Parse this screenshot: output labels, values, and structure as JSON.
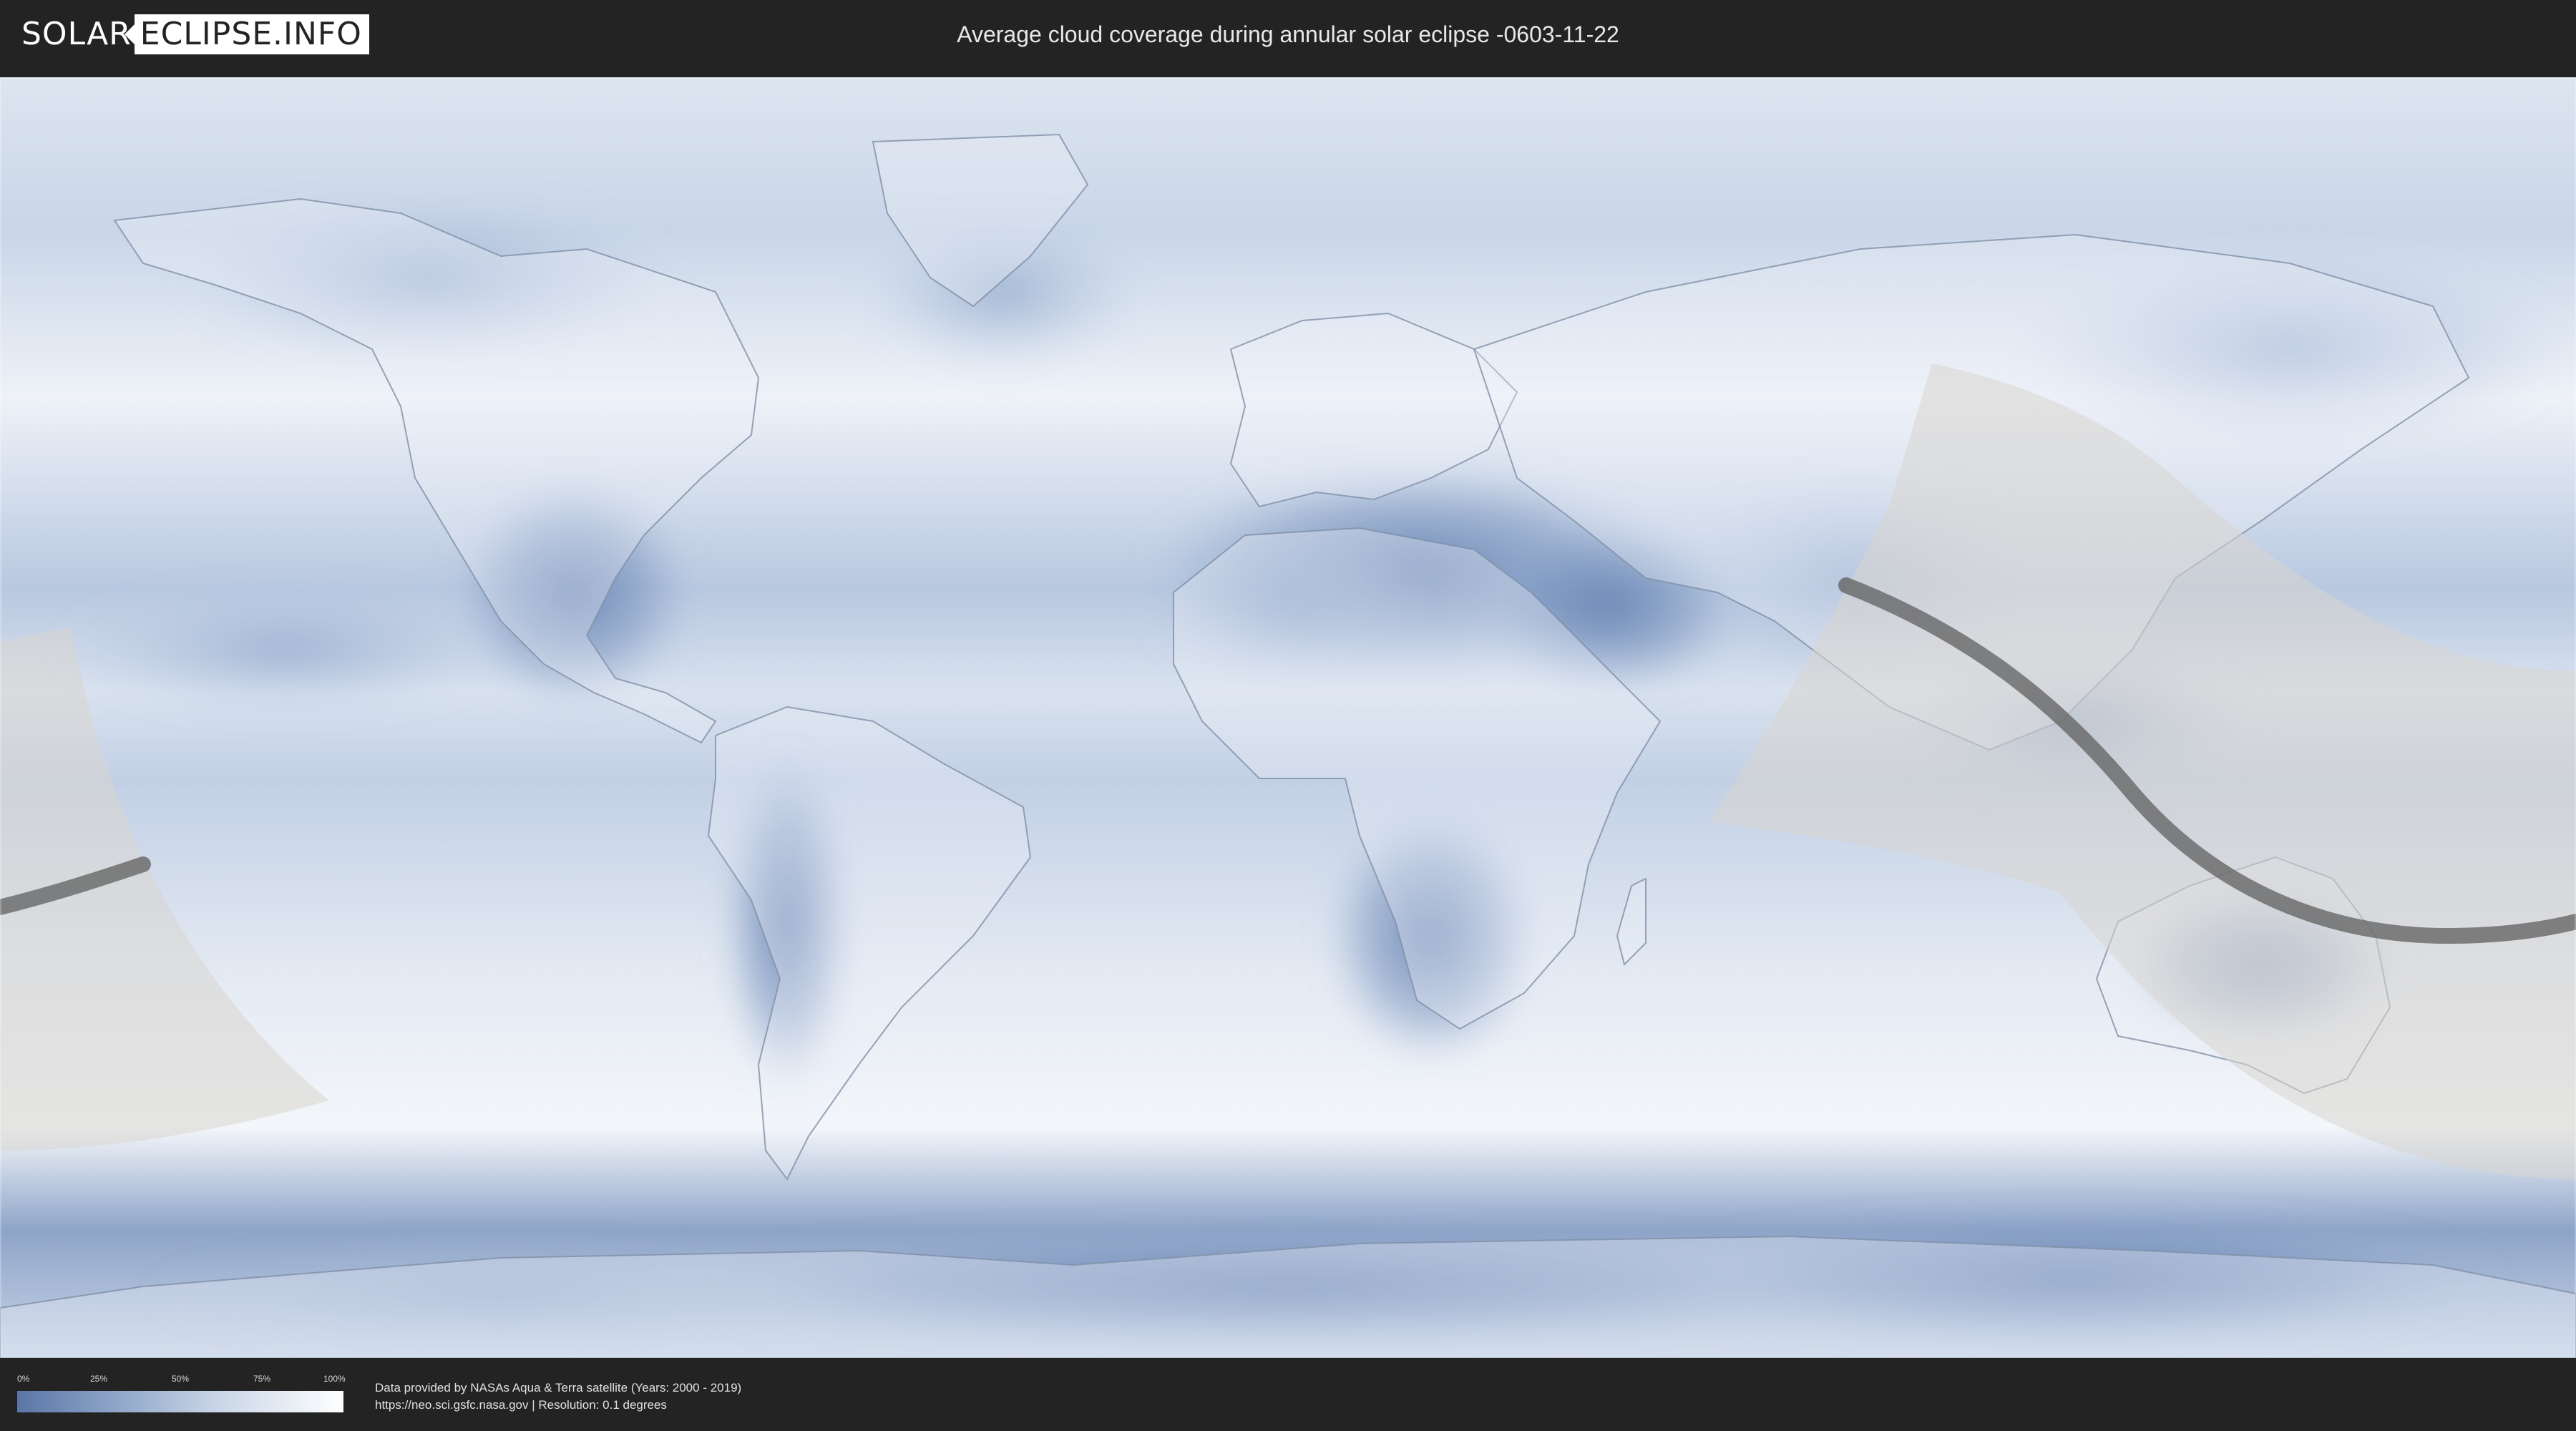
{
  "header": {
    "logo_part1": "SOLAR",
    "logo_part2": "ECLIPSE.INFO",
    "title": "Average cloud coverage during annular solar eclipse -0603-11-22"
  },
  "legend": {
    "ticks": [
      "0%",
      "25%",
      "50%",
      "75%",
      "100%"
    ],
    "colors": {
      "low": "#5a76a6",
      "mid": "#c7d4e6",
      "high": "#ffffff"
    }
  },
  "credits": {
    "line1": "Data provided by NASAs Aqua & Terra satellite (Years: 2000 - 2019)",
    "line2": "https://neo.sci.gsfc.nasa.gov | Resolution: 0.1 degrees"
  },
  "map": {
    "background": "#e9eef6",
    "land_color": "#eef2f8",
    "cloud_dark": "#6a86b4",
    "eclipse_zone_color": "#d8d6d0",
    "central_line_color": "#5f5f5f"
  }
}
